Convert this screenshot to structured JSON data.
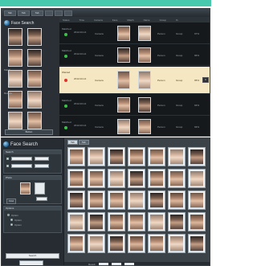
{
  "top_window": {
    "menu_tabs": [
      "Tab",
      "Tab",
      "Tab",
      "",
      "",
      "",
      "",
      ""
    ],
    "brand": "Face Search",
    "left_faces": [
      {
        "tone": "dark"
      },
      {
        "tone": "dark"
      },
      {
        "tone": "mid"
      },
      {
        "tone": "dark"
      },
      {
        "tone": "light"
      },
      {
        "tone": "mid"
      },
      {
        "tone": "mid"
      },
      {
        "tone": "light"
      },
      {
        "tone": "light"
      },
      {
        "tone": "mid"
      }
    ],
    "left_labels": [
      "Match",
      "Results"
    ],
    "left_button": "Button",
    "table_headers": [
      "Status",
      "Time",
      "Camera",
      "Face",
      "Match",
      "Name",
      "Group",
      "%"
    ],
    "rows": [
      {
        "status": "Matched",
        "dot_color": "#3cc24a",
        "time": "2012-02-14",
        "camera": "Camera",
        "text1": "Person",
        "text2": "Group",
        "pct": "97%",
        "highlight": false,
        "chip": ""
      },
      {
        "status": "Matched",
        "dot_color": "#3cc24a",
        "time": "2012-02-14",
        "camera": "Camera",
        "text1": "Person",
        "text2": "Group",
        "pct": "96%",
        "highlight": false,
        "chip": ""
      },
      {
        "status": "Wanted",
        "dot_color": "#e0312a",
        "time": "2012-02-14",
        "camera": "Camera",
        "text1": "Person",
        "text2": "Group",
        "pct": "95%",
        "highlight": true,
        "chip": "1"
      },
      {
        "status": "Matched",
        "dot_color": "#3cc24a",
        "time": "2012-02-14",
        "camera": "Camera",
        "text1": "Person",
        "text2": "Group",
        "pct": "94%",
        "highlight": false,
        "chip": ""
      },
      {
        "status": "Matched",
        "dot_color": "#3cc24a",
        "time": "2012-02-14",
        "camera": "Camera",
        "text1": "Person",
        "text2": "Group",
        "pct": "93%",
        "highlight": false,
        "chip": ""
      }
    ]
  },
  "bottom_window": {
    "brand": "Face Search",
    "panels": {
      "search": "Search",
      "photo": "Photo",
      "options": "Options"
    },
    "field_values": [
      "",
      "",
      "",
      ""
    ],
    "radio_labels": [
      "Option",
      "Option",
      "Option"
    ],
    "buttons": [
      "Find",
      "Search"
    ],
    "tabs": [
      "Tab",
      "Tab"
    ],
    "footer": [
      "Result",
      "",
      "",
      ""
    ]
  }
}
